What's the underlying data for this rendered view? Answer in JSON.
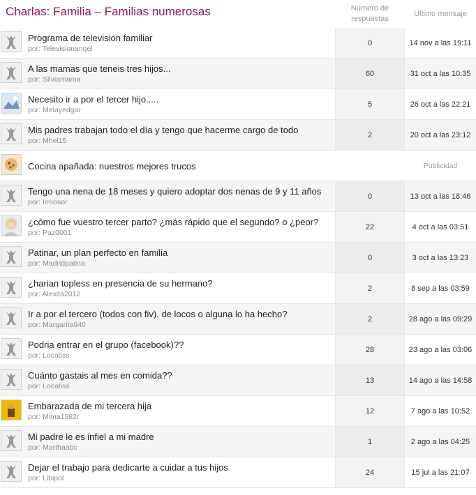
{
  "header": {
    "title": "Charlas: Familia – Familias numerosas",
    "col_replies": "Número de respuestas",
    "col_last": "Ultimo mensaje"
  },
  "threads": [
    {
      "title": "Programa de television familiar",
      "author": "por: Televisionangel",
      "replies": "0",
      "last": "14 nov a las 19:11",
      "avatar": "default-avatar"
    },
    {
      "title": "A las mamas que teneis tres hijos...",
      "author": "por: Silviamama",
      "replies": "60",
      "last": "31 oct a las 10:35",
      "avatar": "default-avatar"
    },
    {
      "title": "Necesito ir a por el tercer hijo.....",
      "author": "por: Melayedgar",
      "replies": "5",
      "last": "26 oct a las 22:21",
      "avatar": "photo-avatar"
    },
    {
      "title": "Mis padres trabajan todo el día y tengo que hacerme cargo de todo",
      "author": "por: Mhel15",
      "replies": "2",
      "last": "20 oct a las 23:12",
      "avatar": "default-avatar"
    },
    {
      "title": "Cocina apañada: nuestros mejores trucos",
      "author": "",
      "replies": "",
      "last": "Publicidad",
      "avatar": "food-avatar",
      "ad": true
    },
    {
      "title": "Tengo una nena de 18 meses y quiero adoptar dos nenas de 9 y 11 años",
      "author": "por: Irmosor",
      "replies": "0",
      "last": "13 oct a las 18:46",
      "avatar": "default-avatar"
    },
    {
      "title": "¿cómo fue vuestro tercer parto? ¿más rápido que el segundo? o ¿peor?",
      "author": "por: Paz0001",
      "replies": "22",
      "last": "4 oct a las 03:51",
      "avatar": "face-avatar"
    },
    {
      "title": "Patinar, un plan perfecto en familia",
      "author": "por: Madridpatina",
      "replies": "0",
      "last": "3 oct a las 13:23",
      "avatar": "default-avatar"
    },
    {
      "title": "¿harian topless en presencia de su hermano?",
      "author": "por: Alexita2012",
      "replies": "2",
      "last": "8 sep a las 03:59",
      "avatar": "default-avatar"
    },
    {
      "title": "Ir a por el tercero (todos con fiv). de locos o alguna lo ha hecho?",
      "author": "por: Margarita940",
      "replies": "2",
      "last": "28 ago a las 09:29",
      "avatar": "default-avatar"
    },
    {
      "title": "Podria entrar en el grupo (facebook)??",
      "author": "por: Locatiss",
      "replies": "28",
      "last": "23 ago a las 03:06",
      "avatar": "default-avatar"
    },
    {
      "title": "Cuánto gastais al mes en comida??",
      "author": "por: Locatiss",
      "replies": "13",
      "last": "14 ago a las 14:58",
      "avatar": "default-avatar"
    },
    {
      "title": "Embarazada de mi tercera hija",
      "author": "por: Mima1982r",
      "replies": "12",
      "last": "7 ago a las 10:52",
      "avatar": "yellow-avatar"
    },
    {
      "title": "Mi padre le es infiel a mi madre",
      "author": "por: Marthaabc",
      "replies": "1",
      "last": "2 ago a las 04:25",
      "avatar": "default-avatar"
    },
    {
      "title": "Dejar el trabajo para dedicarte a cuidar a tus hijos",
      "author": "por: Libipol",
      "replies": "24",
      "last": "15 jul a las 21:07",
      "avatar": "default-avatar"
    }
  ]
}
